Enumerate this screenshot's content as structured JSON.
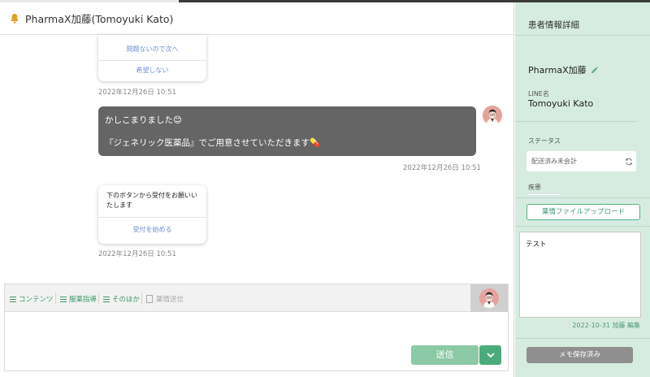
{
  "chat": {
    "title": "PharmaX加藤(Tomoyuki Kato)",
    "messages": [
      {
        "type": "card",
        "options": [
          "問題ないので次へ",
          "希望しない"
        ],
        "timestamp": "2022年12月26日 10:51"
      },
      {
        "type": "text",
        "line1": "かしこまりました😊",
        "line2": "『ジェネリック医薬品』でご用意させていただきます💊",
        "timestamp": "2022年12月26日 10:51"
      },
      {
        "type": "card",
        "text": "下のボタンから受付をお願いいたします",
        "action": "受付を始める",
        "timestamp": "2022年12月26日 10:51"
      }
    ]
  },
  "composer": {
    "tools": [
      "コンテンツ",
      "服薬指導",
      "そのほか",
      "薬情送信"
    ],
    "send_label": "送信"
  },
  "panel": {
    "title": "患者情報詳細",
    "pharmacist_name": "PharmaX加藤",
    "line_label": "LINE名",
    "line_name": "Tomoyuki Kato",
    "status_label": "ステータス",
    "status_value": "配送済み未会計",
    "disease_label": "疾患",
    "upload_label": "薬情ファイルアップロード",
    "memo_text": "テスト",
    "memo_meta": "2022-10-31 加藤 編集",
    "save_label": "メモ保存済み"
  },
  "colors": {
    "accent": "#3f9a6c",
    "panel_bg": "#d7ece0",
    "dark_bubble": "#656565",
    "send": "#8cc9a6"
  }
}
